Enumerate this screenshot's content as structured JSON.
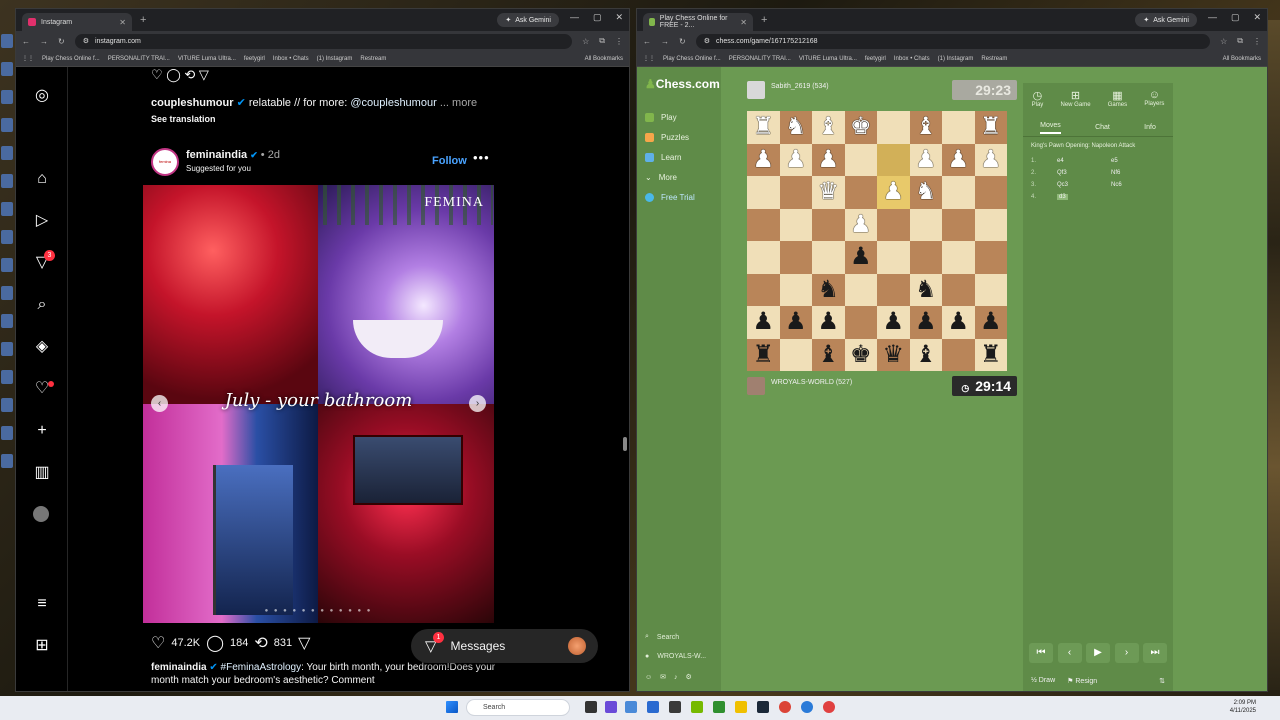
{
  "left_window": {
    "tab_title": "Instagram",
    "url": "instagram.com",
    "ask_gemini": "Ask Gemini",
    "bookmarks": [
      "Play Chess Online f...",
      "PERSONALITY TRAI...",
      "VITURE Luma Ultra...",
      "feetygirl",
      "Inbox • Chats",
      "(1) Instagram",
      "Restream"
    ],
    "all_bookmarks": "All Bookmarks"
  },
  "instagram": {
    "prev_caption": {
      "user": "coupleshumour",
      "text": "relatable // for more:",
      "mention": "@coupleshumour",
      "more": "... more",
      "see_translation": "See translation"
    },
    "post": {
      "user": "feminaindia",
      "time": "2d",
      "suggested": "Suggested for you",
      "follow": "Follow",
      "brand": "FEMINA",
      "overlay": "July - your bathroom",
      "likes": "47.2K",
      "comments": "184",
      "reposts": "831",
      "caption_user": "feminaindia",
      "caption_tag": "#FeminaAstrology",
      "caption_text": ": Your birth month, your bedroom!Does your month match your bedroom's aesthetic? Comment"
    },
    "nav_badge": "3",
    "messages_label": "Messages",
    "messages_badge": "1"
  },
  "right_window": {
    "tab_title": "Play Chess Online for FREE - 2...",
    "url": "chess.com/game/167175212168",
    "ask_gemini": "Ask Gemini",
    "bookmarks": [
      "Play Chess Online f...",
      "PERSONALITY TRAI...",
      "VITURE Luma Ultra...",
      "feetygirl",
      "Inbox • Chats",
      "(1) Instagram",
      "Restream"
    ],
    "all_bookmarks": "All Bookmarks"
  },
  "chess": {
    "logo": "Chess.com",
    "nav": [
      "Play",
      "Puzzles",
      "Learn",
      "More",
      "Free Trial"
    ],
    "search": "Search",
    "user_short": "WROYALS-W...",
    "opponent": "Sabith_2619 (534)",
    "opponent_clock": "29:23",
    "me": "WROYALS-WORLD (527)",
    "my_clock": "29:14",
    "panel_tabs": [
      "Play",
      "New Game",
      "Games",
      "Players"
    ],
    "sub_tabs": [
      "Moves",
      "Chat",
      "Info"
    ],
    "opening": "King's Pawn Opening: Napoleon Attack",
    "moves": [
      {
        "n": "1.",
        "w": "e4",
        "b": "e5"
      },
      {
        "n": "2.",
        "w": "Qf3",
        "b": "Nf6"
      },
      {
        "n": "3.",
        "w": "Qc3",
        "b": "Nc6"
      },
      {
        "n": "4.",
        "w": "d3",
        "b": ""
      }
    ],
    "draw": "Draw",
    "resign": "Resign"
  },
  "taskbar": {
    "search": "Search",
    "time": "2:09 PM",
    "date": "4/11/2025"
  }
}
